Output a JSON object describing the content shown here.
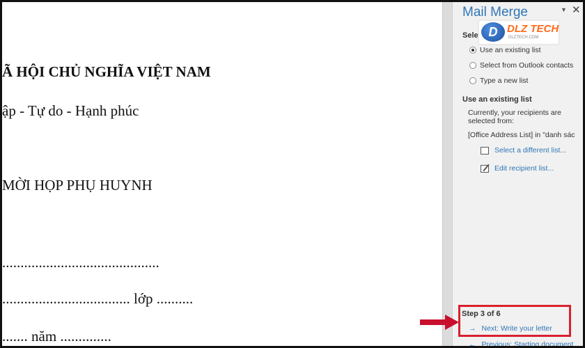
{
  "document": {
    "lines": [
      "Ã HỘI CHỦ NGHĨA VIỆT NAM",
      "ập - Tự do - Hạnh phúc",
      "MỜI HỌP PHỤ HUYNH",
      "...........................................",
      "................................... lớp ..........",
      "....... năm .............."
    ]
  },
  "pane": {
    "title": "Mail Merge",
    "menu_icon": "▼",
    "close_icon": "✕",
    "select_recipients_heading": "Select recipients",
    "options": [
      "Use an existing list",
      "Select from Outlook contacts",
      "Type a new list"
    ],
    "existing_list_heading": "Use an existing list",
    "info_line1": "Currently, your recipients are",
    "info_line2": "selected from:",
    "info_line3": "[Office Address List] in \"danh sác",
    "select_different_link": "Select a different list...",
    "edit_recipient_link": "Edit recipient list..."
  },
  "logo": {
    "mark": "D",
    "text": "DLZ TECH",
    "sub": "DLZTECH.COM"
  },
  "steps": {
    "label": "Step 3 of 6",
    "next": "Next: Write your letter",
    "previous": "Previous: Starting document"
  },
  "colors": {
    "accent": "#2e75b6",
    "highlight": "#d9202e"
  }
}
